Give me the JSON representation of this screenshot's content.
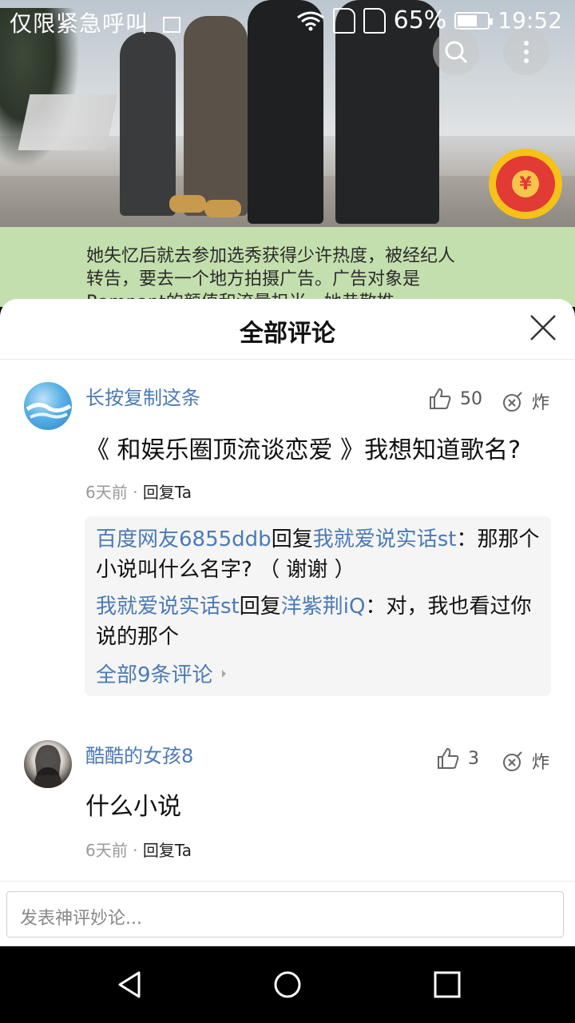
{
  "status_bar": {
    "carrier_text": "仅限紧急呼叫",
    "battery_percent": "65%",
    "battery_level": 0.65,
    "time": "19:52",
    "icons": [
      "image-icon",
      "wifi-icon",
      "sim-1-icon",
      "sim-2-icon",
      "battery-icon"
    ]
  },
  "background": {
    "article_text": "她失忆后就去参加选秀获得少许热度，被经纪人转告，要去一个地方拍摄广告。广告对象是Rampant的颜值和流量担当，她恭敬推"
  },
  "overlay": {
    "search_icon": "search-icon",
    "more_icon": "more-vertical-icon",
    "red_packet_symbol": "¥"
  },
  "comments_sheet": {
    "title": "全部评论",
    "close_icon": "close-icon",
    "comments": [
      {
        "username": "长按复制这条",
        "likes": "50",
        "zha_label": "炸",
        "text": "《 和娱乐圈顶流谈恋爱 》我想知道歌名?",
        "time": "6天前",
        "separator": "·",
        "reply_label": "回复Ta",
        "replies": [
          {
            "from": "百度网友6855ddb",
            "action": "回复",
            "to": "我就爱说实话st",
            "colon": "：",
            "text": "那那个小说叫什么名字? （ 谢谢 ）"
          },
          {
            "from": "我就爱说实话st",
            "action": "回复",
            "to": "洋紫荆iQ",
            "colon": "：",
            "text": "对，我也看过你说的那个"
          }
        ],
        "all_replies_label": "全部9条评论"
      },
      {
        "username": "酷酷的女孩8",
        "likes": "3",
        "zha_label": "炸",
        "text": "什么小说",
        "time": "6天前",
        "separator": "·",
        "reply_label": "回复Ta"
      }
    ],
    "input_placeholder": "发表神评妙论..."
  },
  "nav_bar": {
    "back_icon": "back-triangle-icon",
    "home_icon": "home-circle-icon",
    "recents_icon": "recents-square-icon"
  },
  "colors": {
    "username_blue": "#4b7ab6",
    "article_bg": "#c4dfae",
    "red_packet_red": "#e23a35",
    "red_packet_gold": "#f6c21a"
  }
}
